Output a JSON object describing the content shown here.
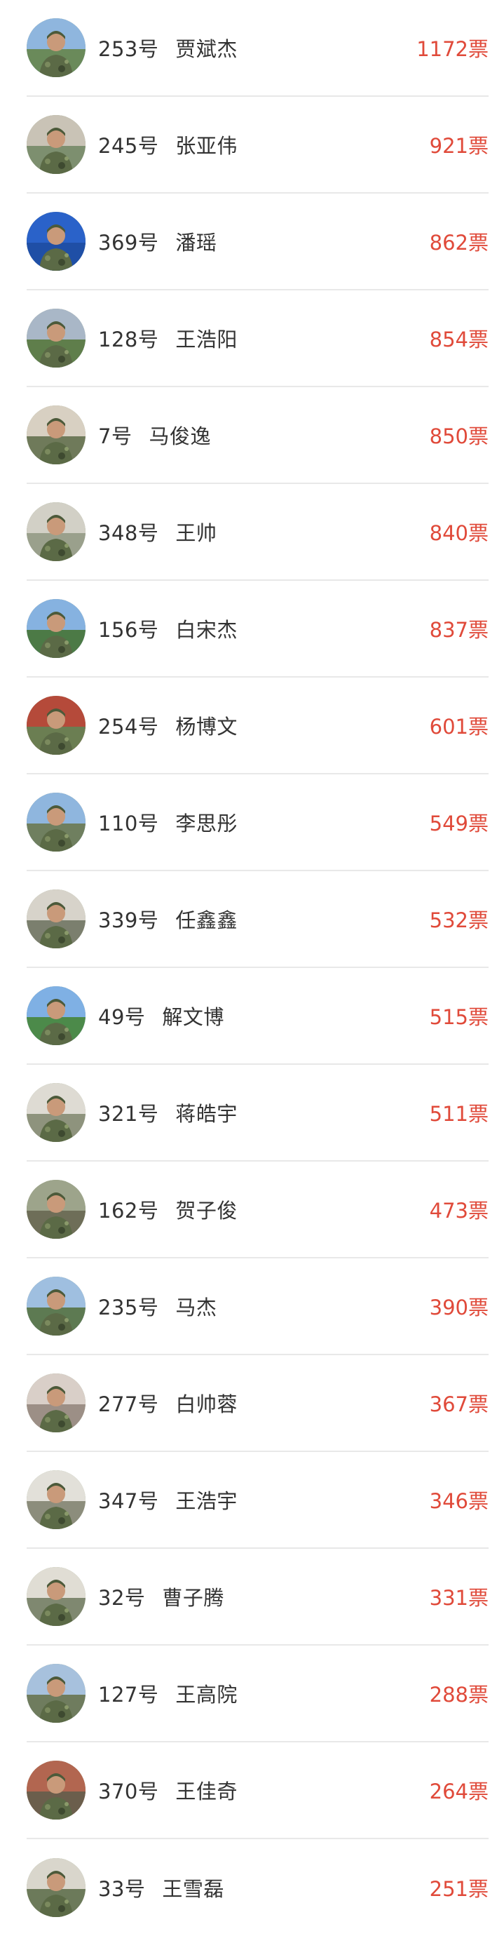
{
  "ranking": {
    "entries": [
      {
        "number": "253号",
        "name": "贾斌杰",
        "votes": "1172票",
        "bg": "#6a8a5a",
        "sky": "#8fb6de"
      },
      {
        "number": "245号",
        "name": "张亚伟",
        "votes": "921票",
        "bg": "#7d8f6f",
        "sky": "#c9c3b6"
      },
      {
        "number": "369号",
        "name": "潘瑶",
        "votes": "862票",
        "bg": "#1f4fa6",
        "sky": "#2a62c9"
      },
      {
        "number": "128号",
        "name": "王浩阳",
        "votes": "854票",
        "bg": "#5f7e4b",
        "sky": "#a9b7c7"
      },
      {
        "number": "7号",
        "name": "马俊逸",
        "votes": "850票",
        "bg": "#6f7a5a",
        "sky": "#d8d0c2"
      },
      {
        "number": "348号",
        "name": "王帅",
        "votes": "840票",
        "bg": "#9aa08c",
        "sky": "#d2d0c6"
      },
      {
        "number": "156号",
        "name": "白宋杰",
        "votes": "837票",
        "bg": "#4c7a46",
        "sky": "#86b2e0"
      },
      {
        "number": "254号",
        "name": "杨博文",
        "votes": "601票",
        "bg": "#6b7e52",
        "sky": "#b54a3a"
      },
      {
        "number": "110号",
        "name": "李思彤",
        "votes": "549票",
        "bg": "#6f7f5f",
        "sky": "#8fb6de"
      },
      {
        "number": "339号",
        "name": "任鑫鑫",
        "votes": "532票",
        "bg": "#7b7f6e",
        "sky": "#d7d3ca"
      },
      {
        "number": "49号",
        "name": "解文博",
        "votes": "515票",
        "bg": "#4c8a4a",
        "sky": "#7fb0e4"
      },
      {
        "number": "321号",
        "name": "蒋皓宇",
        "votes": "511票",
        "bg": "#8e937d",
        "sky": "#dedbd3"
      },
      {
        "number": "162号",
        "name": "贺子俊",
        "votes": "473票",
        "bg": "#6e6e58",
        "sky": "#9da48b"
      },
      {
        "number": "235号",
        "name": "马杰",
        "votes": "390票",
        "bg": "#5d7a52",
        "sky": "#9fbfe0"
      },
      {
        "number": "277号",
        "name": "白帅蓉",
        "votes": "367票",
        "bg": "#9c8f86",
        "sky": "#d9cfc8"
      },
      {
        "number": "347号",
        "name": "王浩宇",
        "votes": "346票",
        "bg": "#8c8d7c",
        "sky": "#e2e0d9"
      },
      {
        "number": "32号",
        "name": "曹子腾",
        "votes": "331票",
        "bg": "#7f8870",
        "sky": "#e0ddd4"
      },
      {
        "number": "127号",
        "name": "王高院",
        "votes": "288票",
        "bg": "#6f7c5e",
        "sky": "#a7c1dd"
      },
      {
        "number": "370号",
        "name": "王佳奇",
        "votes": "264票",
        "bg": "#6b5e4c",
        "sky": "#b26650"
      },
      {
        "number": "33号",
        "name": "王雪磊",
        "votes": "251票",
        "bg": "#6c7a5a",
        "sky": "#d9d6cc"
      }
    ]
  }
}
